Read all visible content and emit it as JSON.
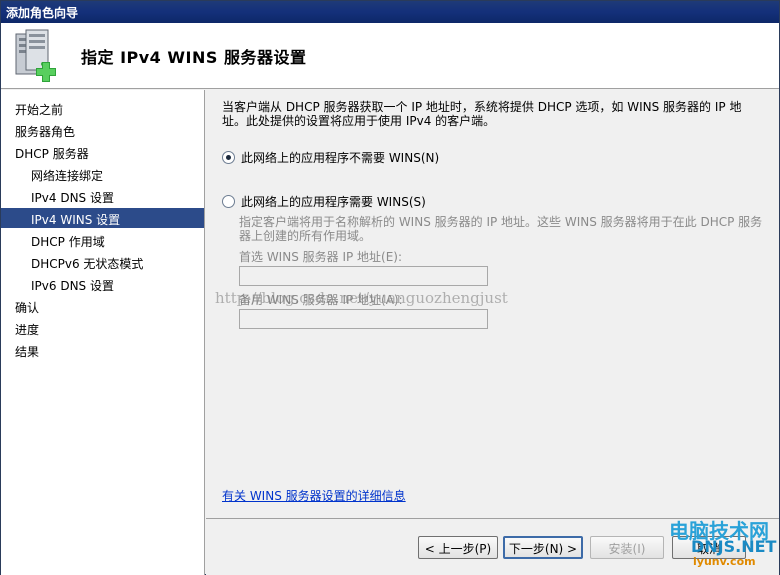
{
  "window": {
    "title": "添加角色向导"
  },
  "header": {
    "title": "指定 IPv4 WINS 服务器设置"
  },
  "sidebar": {
    "items": [
      {
        "label": "开始之前",
        "sub": false,
        "selected": false
      },
      {
        "label": "服务器角色",
        "sub": false,
        "selected": false
      },
      {
        "label": "DHCP 服务器",
        "sub": false,
        "selected": false
      },
      {
        "label": "网络连接绑定",
        "sub": true,
        "selected": false
      },
      {
        "label": "IPv4 DNS 设置",
        "sub": true,
        "selected": false
      },
      {
        "label": "IPv4 WINS 设置",
        "sub": true,
        "selected": true
      },
      {
        "label": "DHCP 作用域",
        "sub": true,
        "selected": false
      },
      {
        "label": "DHCPv6 无状态模式",
        "sub": true,
        "selected": false
      },
      {
        "label": "IPv6 DNS 设置",
        "sub": true,
        "selected": false
      },
      {
        "label": "确认",
        "sub": false,
        "selected": false
      },
      {
        "label": "进度",
        "sub": false,
        "selected": false
      },
      {
        "label": "结果",
        "sub": false,
        "selected": false
      }
    ]
  },
  "main": {
    "description": "当客户端从 DHCP 服务器获取一个 IP 地址时，系统将提供 DHCP 选项，如 WINS 服务器的 IP 地址。此处提供的设置将应用于使用 IPv4 的客户端。",
    "option_not_required": "此网络上的应用程序不需要 WINS(N)",
    "option_required": "此网络上的应用程序需要 WINS(S)",
    "selected_option": "not_required",
    "required_desc": "指定客户端将用于名称解析的 WINS 服务器的 IP 地址。这些 WINS 服务器将用于在此 DHCP 服务器上创建的所有作用域。",
    "preferred_label": "首选 WINS 服务器 IP 地址(E):",
    "preferred_value": "",
    "alternate_label": "备用 WINS 服务器 IP 地址(A):",
    "alternate_value": "",
    "help_link": "有关 WINS 服务器设置的详细信息"
  },
  "footer": {
    "back": "< 上一步(P)",
    "next": "下一步(N) >",
    "install": "安装(I)",
    "cancel": "取消"
  },
  "watermark": "http://blog.csdn.net/yuanguozhengjust",
  "logo": {
    "line1": "电脑技术网",
    "line2": "DNJS.NET",
    "line3": "iyunv.com"
  }
}
